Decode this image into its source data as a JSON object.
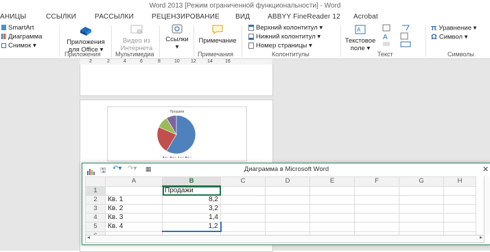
{
  "window": {
    "title": "Word 2013 [Режим ограниченной функциональности] - Word"
  },
  "tabs": [
    "АНИЦЫ",
    "ССЫЛКИ",
    "РАССЫЛКИ",
    "РЕЦЕНЗИРОВАНИЕ",
    "ВИД",
    "ABBYY FineReader 12",
    "Acrobat"
  ],
  "ribbon": {
    "illustrations": {
      "smartart": "SmartArt",
      "chart": "Диаграмма",
      "screenshot": "Снимок ▾"
    },
    "apps": {
      "office_l1": "Приложения",
      "office_l2": "для Office ▾",
      "group": "Приложения"
    },
    "media": {
      "video_l1": "Видео из",
      "video_l2": "Интернета",
      "group": "Мультимедиа"
    },
    "links": {
      "label": "Ссылки",
      "dropdown": "▾"
    },
    "comments": {
      "label": "Примечание",
      "group": "Примечания"
    },
    "header_footer": {
      "header": "Верхний колонтитул ▾",
      "footer": "Нижний колонтитул ▾",
      "page_number": "Номер страницы ▾",
      "group": "Колонтитулы"
    },
    "text": {
      "textbox_l1": "Текстовое",
      "textbox_l2": "поле ▾",
      "group": "Текст"
    },
    "symbols": {
      "equation": "Уравнение ▾",
      "symbol": "Символ ▾",
      "group": "Символы"
    }
  },
  "ruler": [
    "2",
    "2",
    "4",
    "6",
    "8",
    "10",
    "12",
    "14",
    "16"
  ],
  "chart_data": {
    "type": "pie",
    "title": "Продажи",
    "categories": [
      "Кв. 1",
      "Кв. 2",
      "Кв. 3",
      "Кв. 4"
    ],
    "values": [
      8.2,
      3.2,
      1.4,
      1.2
    ],
    "colors": [
      "#4f81bd",
      "#c0504d",
      "#9bbb59",
      "#8064a2"
    ],
    "legend_position": "bottom"
  },
  "sheet": {
    "title": "Диаграмма в Microsoft Word",
    "close": "✕",
    "columns": [
      "",
      "A",
      "B",
      "C",
      "D",
      "E",
      "F",
      "G",
      "H"
    ],
    "rows": [
      {
        "n": "1",
        "a": "",
        "b": "Продажи"
      },
      {
        "n": "2",
        "a": "Кв. 1",
        "b": "8,2"
      },
      {
        "n": "3",
        "a": "Кв. 2",
        "b": "3,2"
      },
      {
        "n": "4",
        "a": "Кв. 3",
        "b": "1,4"
      },
      {
        "n": "5",
        "a": "Кв. 4",
        "b": "1,2"
      },
      {
        "n": "6",
        "a": "",
        "b": ""
      }
    ]
  }
}
